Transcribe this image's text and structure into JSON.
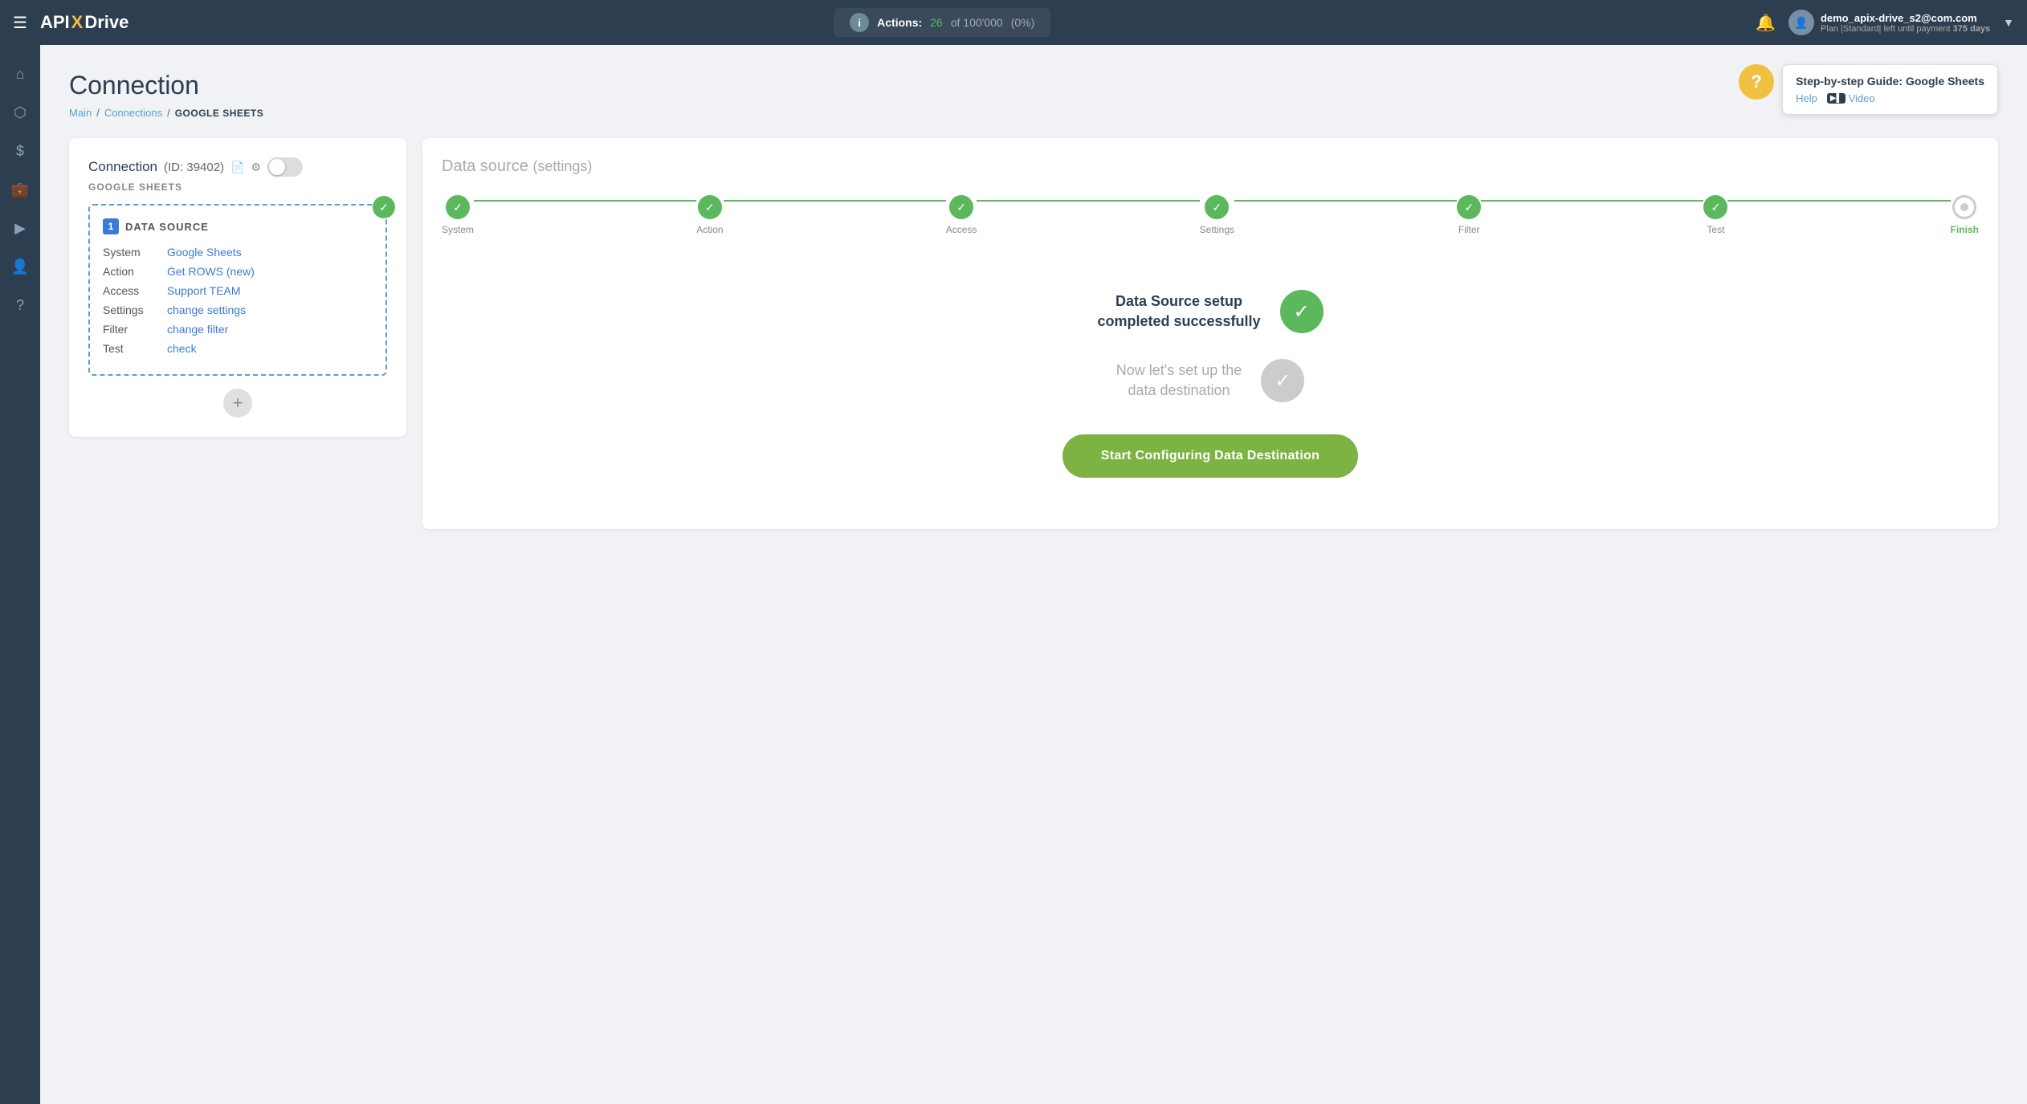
{
  "topnav": {
    "logo": "APIXDrive",
    "logo_api": "API",
    "logo_x": "X",
    "logo_drive": "Drive",
    "actions_label": "Actions:",
    "actions_count": "26",
    "actions_separator": "of",
    "actions_total": "100'000",
    "actions_percent": "(0%)",
    "user_email": "demo_apix-drive_s2@com.com",
    "user_plan": "Plan |Standard| left until payment",
    "user_days": "375 days"
  },
  "sidebar": {
    "items": [
      {
        "name": "home",
        "icon": "⌂"
      },
      {
        "name": "connections",
        "icon": "⬡"
      },
      {
        "name": "billing",
        "icon": "$"
      },
      {
        "name": "briefcase",
        "icon": "💼"
      },
      {
        "name": "play",
        "icon": "▶"
      },
      {
        "name": "user",
        "icon": "👤"
      },
      {
        "name": "help",
        "icon": "?"
      }
    ]
  },
  "page": {
    "title": "Connection",
    "breadcrumb_main": "Main",
    "breadcrumb_connections": "Connections",
    "breadcrumb_current": "GOOGLE SHEETS"
  },
  "help": {
    "question_mark": "?",
    "popup_title": "Step-by-step Guide: Google Sheets",
    "help_link": "Help",
    "video_link": "Video"
  },
  "left_card": {
    "connection_label": "Connection",
    "connection_id": "(ID: 39402)",
    "service_label": "GOOGLE SHEETS",
    "data_source_num": "1",
    "data_source_title": "DATA SOURCE",
    "rows": [
      {
        "label": "System",
        "value": "Google Sheets"
      },
      {
        "label": "Action",
        "value": "Get ROWS (new)"
      },
      {
        "label": "Access",
        "value": "Support TEAM"
      },
      {
        "label": "Settings",
        "value": "change settings"
      },
      {
        "label": "Filter",
        "value": "change filter"
      },
      {
        "label": "Test",
        "value": "check"
      }
    ],
    "add_btn": "+"
  },
  "right_card": {
    "title": "Data source",
    "title_sub": "(settings)",
    "steps": [
      {
        "label": "System",
        "done": true,
        "active": false
      },
      {
        "label": "Action",
        "done": true,
        "active": false
      },
      {
        "label": "Access",
        "done": true,
        "active": false
      },
      {
        "label": "Settings",
        "done": true,
        "active": false
      },
      {
        "label": "Filter",
        "done": true,
        "active": false
      },
      {
        "label": "Test",
        "done": true,
        "active": false
      },
      {
        "label": "Finish",
        "done": false,
        "active": true
      }
    ],
    "success_title": "Data Source setup\ncompleted successfully",
    "setup_destination": "Now let’s set up the\ndata destination",
    "cta_button": "Start Configuring Data Destination"
  }
}
